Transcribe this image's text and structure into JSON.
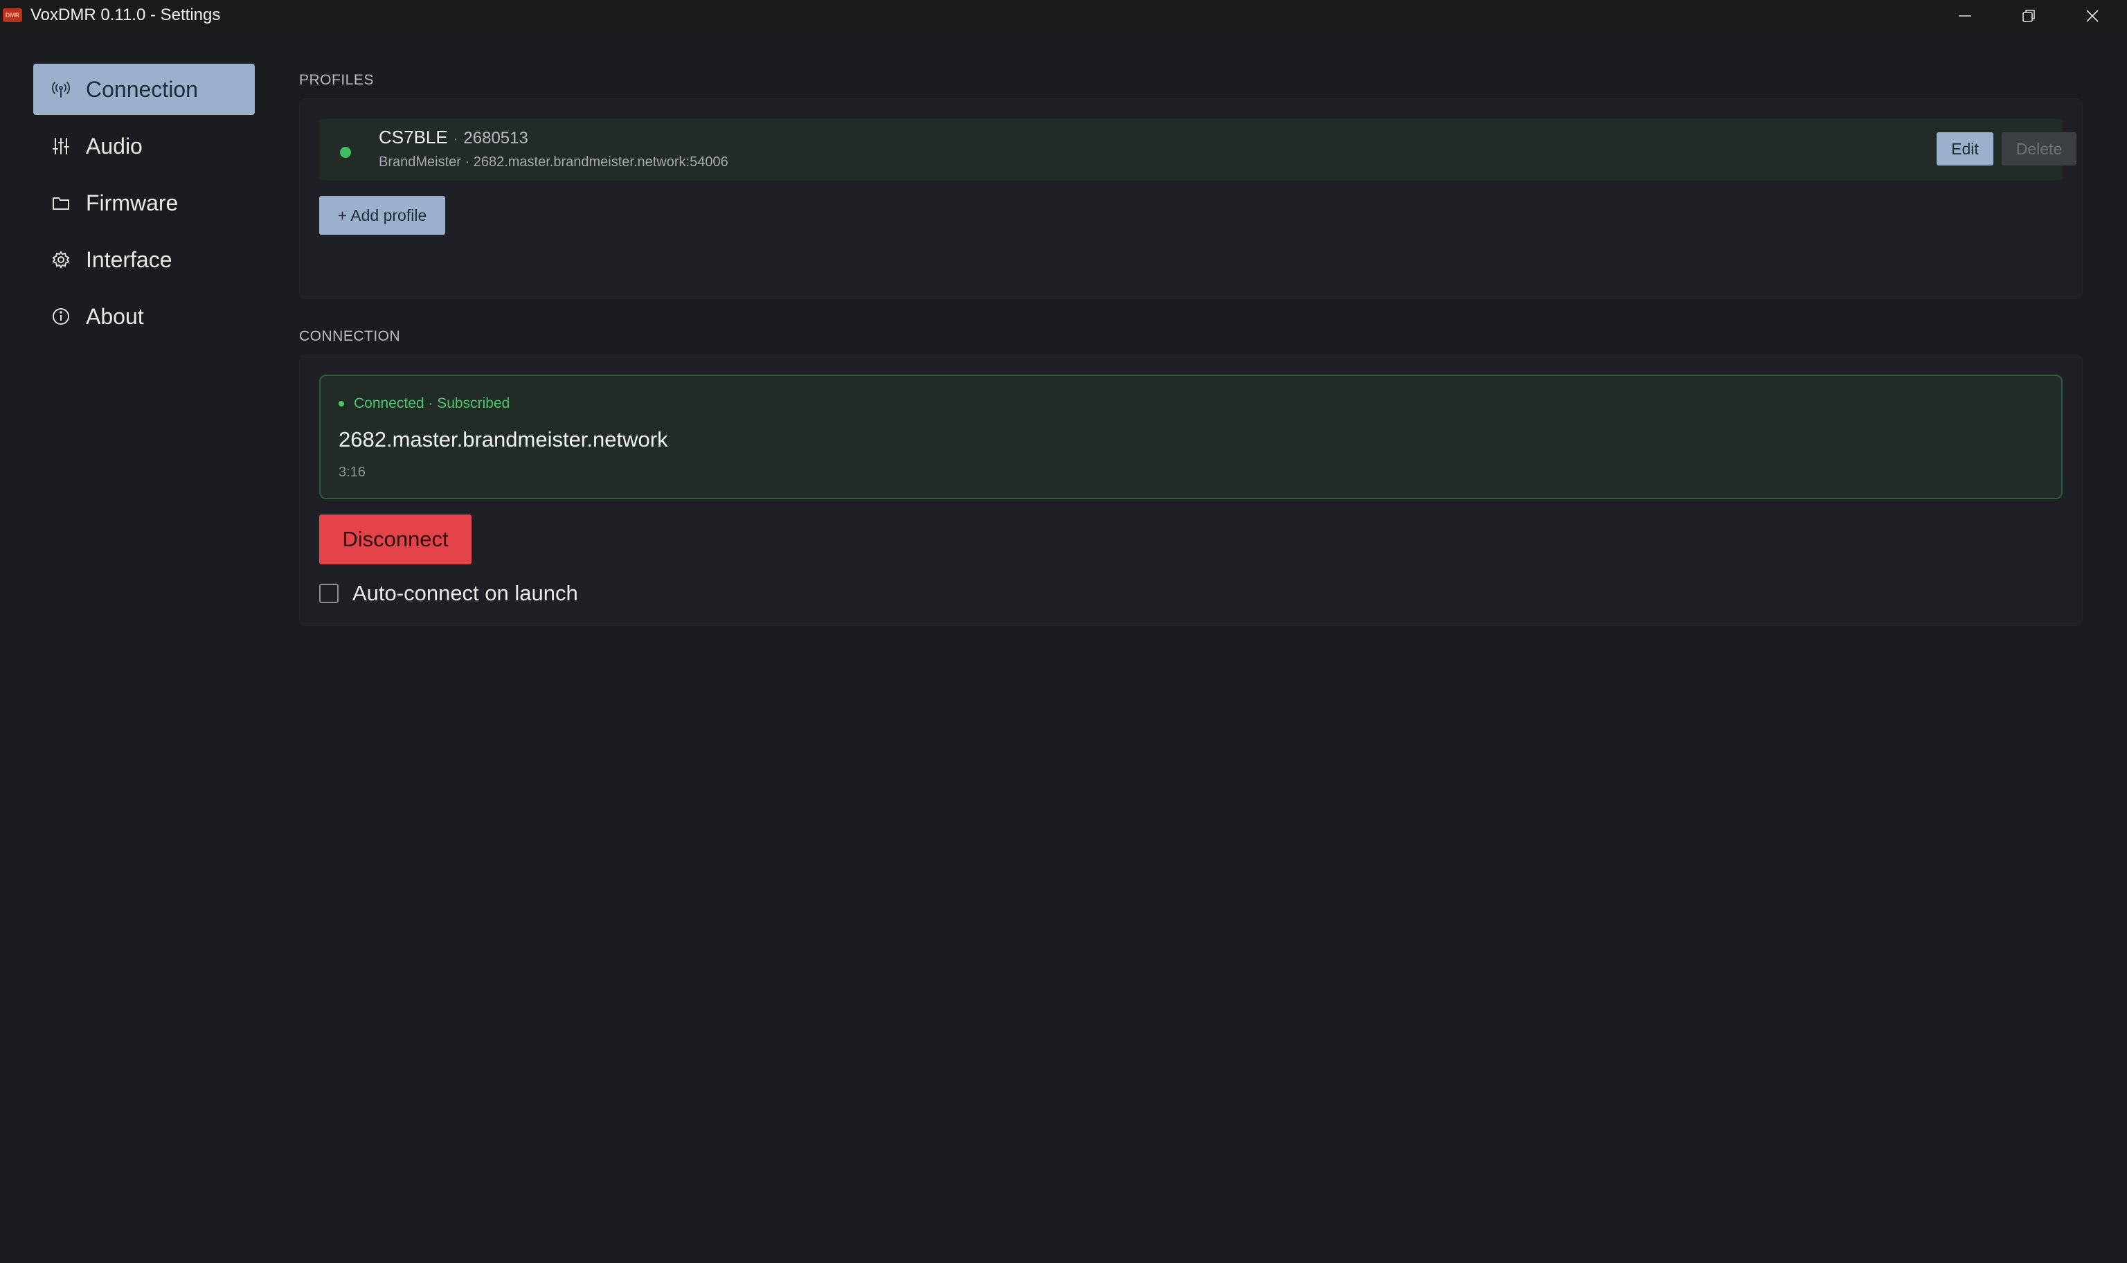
{
  "window": {
    "title": "VoxDMR 0.11.0 - Settings",
    "logo_text": "DMR"
  },
  "sidebar": {
    "items": [
      {
        "label": "Connection",
        "icon": "antenna-icon",
        "active": true
      },
      {
        "label": "Audio",
        "icon": "sliders-icon",
        "active": false
      },
      {
        "label": "Firmware",
        "icon": "folder-icon",
        "active": false
      },
      {
        "label": "Interface",
        "icon": "gear-icon",
        "active": false
      },
      {
        "label": "About",
        "icon": "info-icon",
        "active": false
      }
    ]
  },
  "profiles": {
    "section_label": "PROFILES",
    "items": [
      {
        "name": "CS7BLE",
        "separator": "·",
        "id": "2680513",
        "detail": "BrandMeister · 2682.master.brandmeister.network:54006",
        "active": true
      }
    ],
    "edit_label": "Edit",
    "delete_label": "Delete",
    "add_label": "+ Add profile"
  },
  "connection": {
    "section_label": "CONNECTION",
    "status": "Connected · Subscribed",
    "host": "2682.master.brandmeister.network",
    "elapsed": "3:16",
    "disconnect_label": "Disconnect",
    "autoconnect_label": "Auto-connect on launch",
    "autoconnect_checked": false
  },
  "colors": {
    "accent": "#9ab0cb",
    "danger": "#e5434a",
    "success": "#4cc46a",
    "background": "#1b1c20"
  }
}
